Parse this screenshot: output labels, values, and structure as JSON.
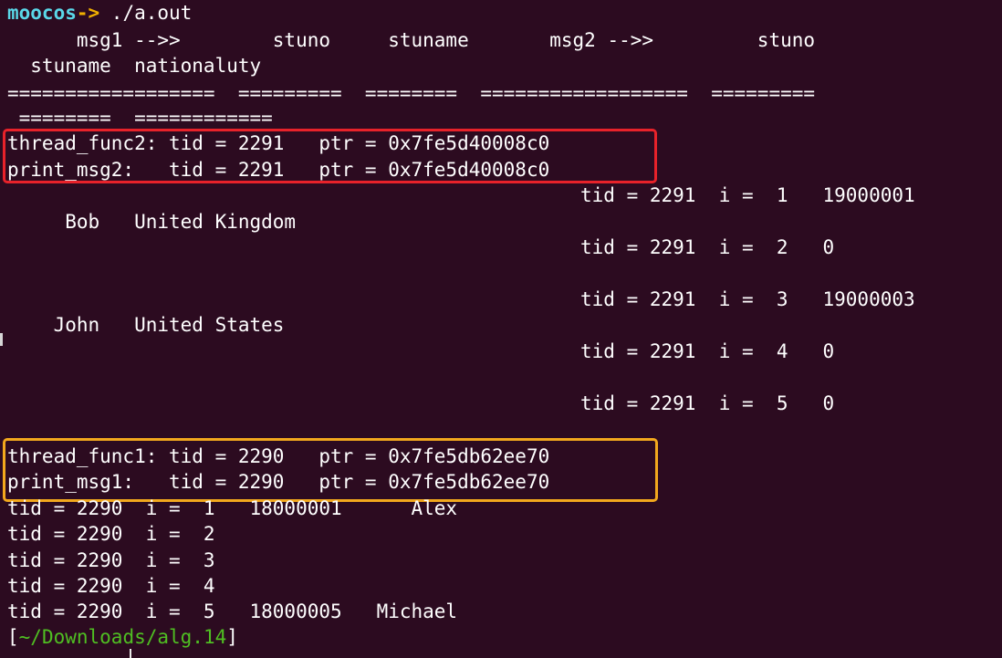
{
  "prompt": {
    "user": "moocos",
    "arrow": "->",
    "command": " ./a.out"
  },
  "header": {
    "line1": "      msg1 -->>        stuno     stuname       msg2 -->>         stuno",
    "line2": "  stuname  nationaluty",
    "sep1": "==================  =========  ========  ==================  =========",
    "sep2": " ========  ============"
  },
  "thread2": {
    "func_line": "thread_func2: tid = 2291   ptr = 0x7fe5d40008c0",
    "print_line": "print_msg2:   tid = 2291   ptr = 0x7fe5d40008c0"
  },
  "right_rows": [
    "tid = 2291  i =  1   19000001",
    "tid = 2291  i =  2   0",
    "tid = 2291  i =  3   19000003",
    "tid = 2291  i =  4   0",
    "tid = 2291  i =  5   0"
  ],
  "left_rows": [
    "     Bob   United Kingdom",
    "    John   United States"
  ],
  "thread1": {
    "func_line": "thread_func1: tid = 2290   ptr = 0x7fe5db62ee70",
    "print_line": "print_msg1:   tid = 2290   ptr = 0x7fe5db62ee70"
  },
  "bottom_rows": [
    "tid = 2290  i =  1   18000001      Alex",
    "tid = 2290  i =  2",
    "tid = 2290  i =  3",
    "tid = 2290  i =  4",
    "tid = 2290  i =  5   18000005   Michael"
  ],
  "final_prompt": {
    "open": "[",
    "path": "~/Downloads/alg.14",
    "close": "]"
  },
  "colors": {
    "background": "#2c0b20",
    "prompt_user": "#5ad7e8",
    "prompt_arrow": "#f0b000",
    "path": "#4fbf22",
    "highlight_red": "#e8222a",
    "highlight_orange": "#f2a81d"
  }
}
